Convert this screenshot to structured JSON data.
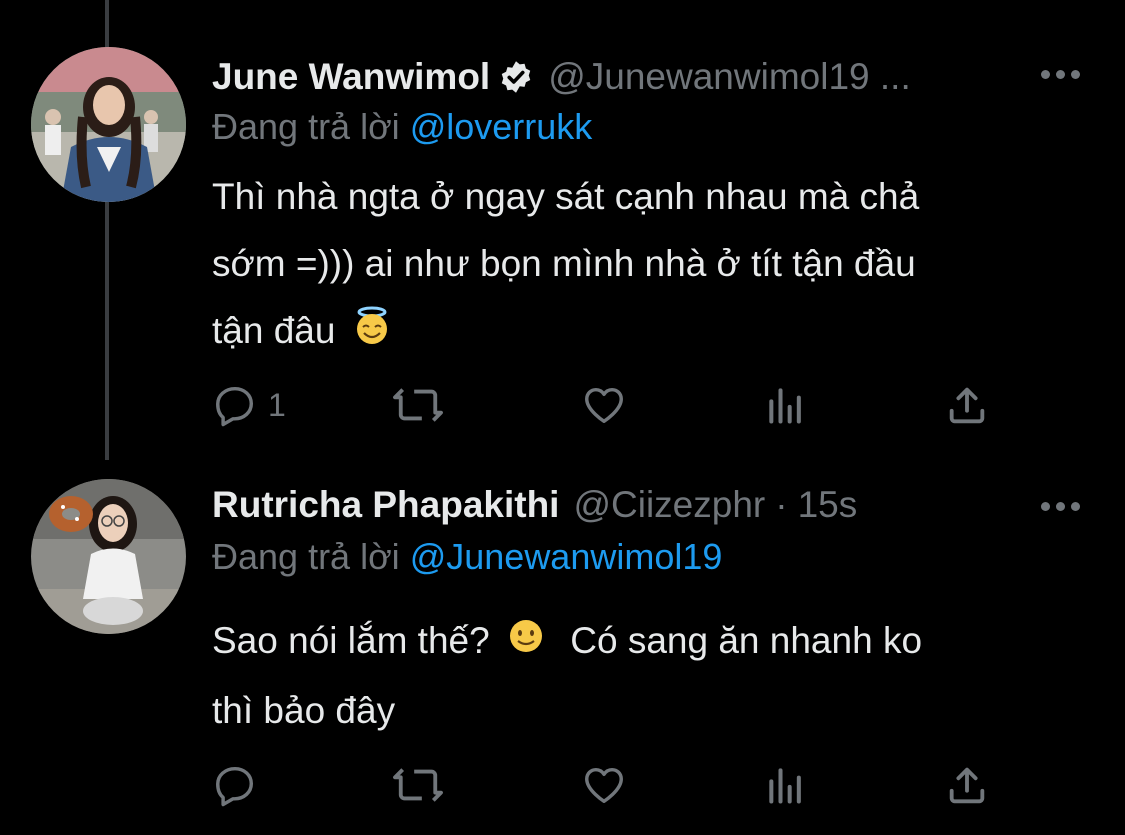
{
  "tweets": [
    {
      "name": "June Wanwimol",
      "verified": true,
      "handle": "@Junewanwimol19 ...",
      "replying_prefix": "Đang trả lời",
      "replying_to": "@loverrukk",
      "text_line1": "Thì nhà ngta ở ngay sát cạnh nhau mà chả",
      "text_line2": "sớm =))) ai như bọn mình nhà ở tít tận đầu",
      "text_line3": "tận đâu",
      "emoji": "smiling-face-with-halo",
      "reply_count": "1"
    },
    {
      "name": "Rutricha Phapakithi",
      "verified": false,
      "handle": "@Ciizezphr",
      "separator": "·",
      "time": "15s",
      "replying_prefix": "Đang trả lời",
      "replying_to": "@Junewanwimol19",
      "text_line1a": "Sao nói lắm thế?",
      "emoji": "slightly-smiling-face",
      "text_line1b": "Có sang ăn nhanh ko",
      "text_line2": "thì bảo đây",
      "reply_count": ""
    }
  ],
  "icons": [
    "reply-icon",
    "retweet-icon",
    "like-icon",
    "views-icon",
    "share-icon",
    "more-icon",
    "verified-badge-icon"
  ],
  "colors": {
    "background": "#000000",
    "text": "#e7e9ea",
    "muted": "#71767b",
    "mention": "#1d9bf0",
    "thread_line": "#3a3d41"
  }
}
